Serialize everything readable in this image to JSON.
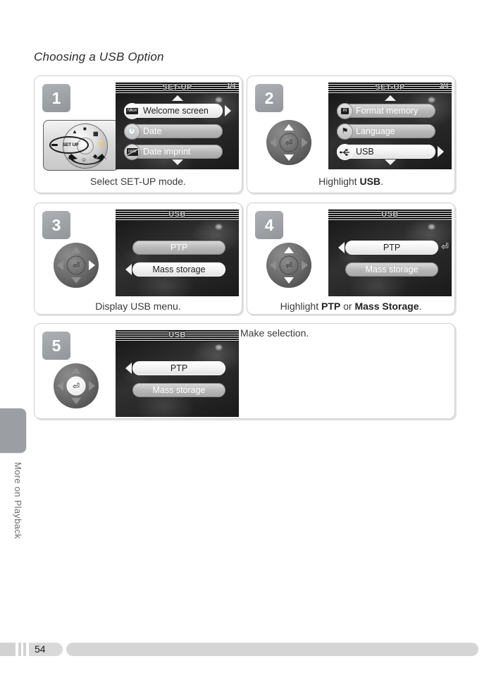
{
  "page": {
    "title": "Choosing a USB Option",
    "number": "54",
    "side_tab_label": "More on Playback"
  },
  "steps": [
    {
      "number": "1",
      "caption": "Select SET-UP mode.",
      "caption_parts": [
        {
          "text": "Select SET",
          "bold": false
        },
        {
          "text": " UP mode.",
          "bold": false
        }
      ],
      "illustration": "mode-dial",
      "dial": {
        "selected_label": "SET UP"
      },
      "screen": {
        "header_title": "SET-UP",
        "page_indicator": "1/4",
        "scroll_up": true,
        "scroll_down": true,
        "items": [
          {
            "label": "Welcome screen",
            "icon": "nikon-logo-icon",
            "selected": true,
            "arrow": "right"
          },
          {
            "label": "Date",
            "icon": "clock-icon",
            "selected": false,
            "arrow": ""
          },
          {
            "label": "Date imprint",
            "icon": "date-imprint-icon",
            "selected": false,
            "arrow": ""
          }
        ]
      }
    },
    {
      "number": "2",
      "caption_pre": "Highlight ",
      "caption_bold": "USB",
      "caption_post": ".",
      "illustration": "dpad",
      "dpad": {
        "up": true,
        "down": true,
        "left": false,
        "right": false,
        "center": false
      },
      "screen": {
        "header_title": "SET-UP",
        "page_indicator": "3/4",
        "scroll_up": true,
        "scroll_down": true,
        "items": [
          {
            "label": "Format memory",
            "icon": "memory-card-icon",
            "selected": false,
            "arrow": ""
          },
          {
            "label": "Language",
            "icon": "flag-icon",
            "selected": false,
            "arrow": ""
          },
          {
            "label": "USB",
            "icon": "usb-icon",
            "selected": true,
            "arrow": "right"
          }
        ]
      }
    },
    {
      "number": "3",
      "caption": "Display USB menu.",
      "illustration": "dpad",
      "dpad": {
        "up": false,
        "down": false,
        "left": false,
        "right": true,
        "center": false
      },
      "screen": {
        "header_title": "USB",
        "page_indicator": "",
        "scroll_up": false,
        "scroll_down": false,
        "items": [
          {
            "label": "PTP",
            "icon": "",
            "selected": false,
            "arrow": ""
          },
          {
            "label": "Mass storage",
            "icon": "",
            "selected": true,
            "arrow": "left"
          }
        ]
      }
    },
    {
      "number": "4",
      "caption_pre": "Highlight ",
      "caption_bold": "PTP",
      "caption_mid": " or ",
      "caption_bold2": "Mass Storage",
      "caption_post": ".",
      "illustration": "dpad",
      "dpad": {
        "up": true,
        "down": true,
        "left": false,
        "right": false,
        "center": false
      },
      "screen": {
        "header_title": "USB",
        "page_indicator": "",
        "scroll_up": false,
        "scroll_down": false,
        "items": [
          {
            "label": "PTP",
            "icon": "",
            "selected": true,
            "arrow": "left",
            "enter_hint": true
          },
          {
            "label": "Mass storage",
            "icon": "",
            "selected": false,
            "arrow": ""
          }
        ]
      }
    },
    {
      "number": "5",
      "caption": "Make selection.",
      "illustration": "dpad",
      "dpad": {
        "up": false,
        "down": false,
        "left": false,
        "right": false,
        "center": true
      },
      "screen": {
        "header_title": "USB",
        "page_indicator": "",
        "scroll_up": false,
        "scroll_down": false,
        "items": [
          {
            "label": "PTP",
            "icon": "",
            "selected": true,
            "arrow": "left"
          },
          {
            "label": "Mass storage",
            "icon": "",
            "selected": false,
            "arrow": ""
          }
        ]
      }
    }
  ],
  "colors": {
    "badge_gray": "#9a9ea3",
    "card_border": "#cfcfcf",
    "text": "#3a3a3a",
    "lcd_dark": "#1a1a1a",
    "selected_row": "#ffffff",
    "normal_row": "#b6b6b6"
  }
}
